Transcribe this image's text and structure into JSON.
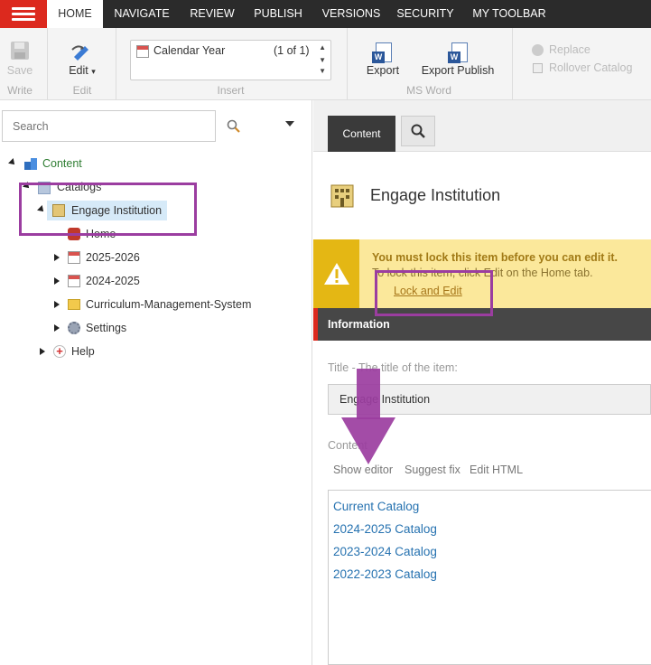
{
  "topnav": {
    "tabs": [
      "HOME",
      "NAVIGATE",
      "REVIEW",
      "PUBLISH",
      "VERSIONS",
      "SECURITY",
      "MY TOOLBAR"
    ],
    "active_tab": "HOME"
  },
  "ribbon": {
    "save_label": "Save",
    "write_label": "Write",
    "edit_btn_label": "Edit",
    "edit_group_label": "Edit",
    "calendar_item": "Calendar Year",
    "calendar_count": "(1 of 1)",
    "insert_label": "Insert",
    "export_label": "Export",
    "export_publish_label": "Export Publish",
    "msword_label": "MS Word",
    "replace_label": "Replace",
    "rollover_label": "Rollover Catalog"
  },
  "tree": {
    "search_placeholder": "Search",
    "content": "Content",
    "catalogs": "Catalogs",
    "engage": "Engage Institution",
    "home": "Home",
    "y2025": "2025-2026",
    "y2024": "2024-2025",
    "cms": "Curriculum-Management-System",
    "settings": "Settings",
    "help": "Help"
  },
  "editor_panel": {
    "tab_content": "Content",
    "item_title": "Engage Institution",
    "warning_title": "You must lock this item before you can edit it.",
    "warning_sub": "To lock this item, click Edit on the Home tab.",
    "lock_and_edit": "Lock and Edit",
    "section_title": "Information",
    "title_label": "Title - The title of the item:",
    "title_value": "Engage Institution",
    "content_label": "Content",
    "show_editor": "Show editor",
    "suggest_fix": "Suggest fix",
    "edit_html": "Edit HTML",
    "links": [
      "Current Catalog",
      "2024-2025 Catalog",
      "2023-2024 Catalog",
      "2022-2023 Catalog"
    ]
  },
  "colors": {
    "brand_red": "#dc291e",
    "nav_dark": "#2b2b2b",
    "annotation_purple": "#9b3da0",
    "warning_yellow": "#fbe89b",
    "link_blue": "#2672b0"
  }
}
